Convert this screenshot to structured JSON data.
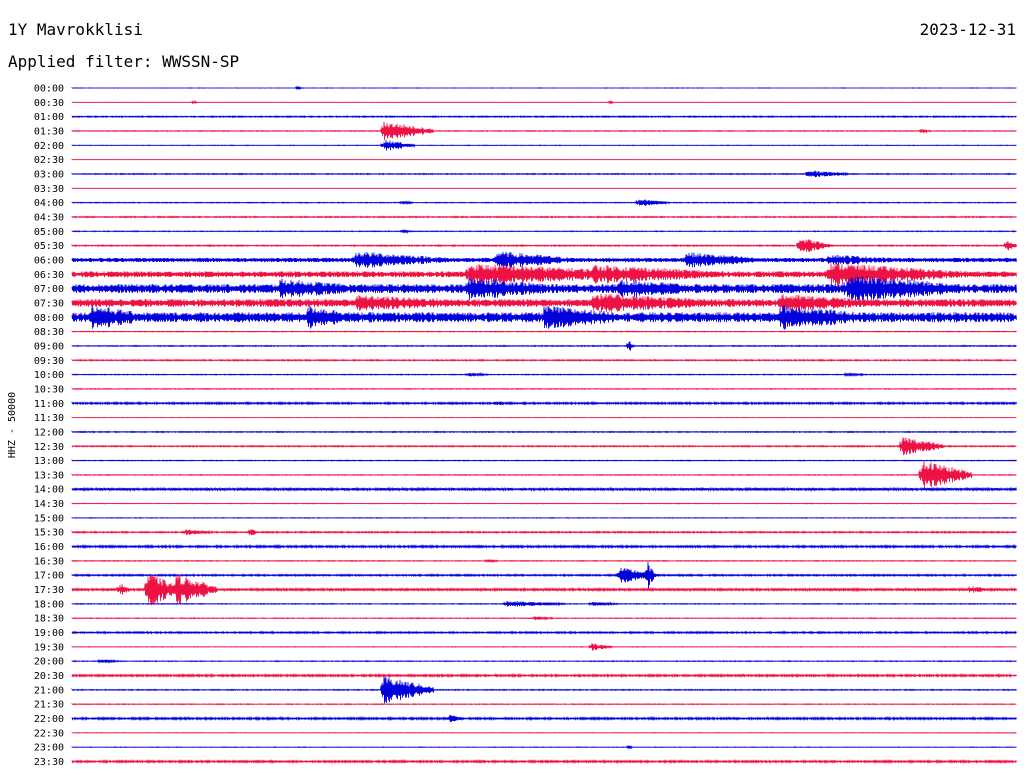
{
  "header": {
    "station": "1Y Mavrokklisi",
    "date": "2023-12-31",
    "filter": "Applied filter: WWSSN-SP"
  },
  "chart_data": {
    "type": "line",
    "title": "1Y Mavrokklisi",
    "ylabel": "HHZ - 50000",
    "colors": [
      "#0000dd",
      "#ee1144"
    ],
    "rows": [
      {
        "time": "00:00",
        "level": 0.2,
        "events": [
          {
            "x": 0.24,
            "amp": 2,
            "dur": 0.002
          }
        ]
      },
      {
        "time": "00:30",
        "level": 0.2,
        "events": [
          {
            "x": 0.13,
            "amp": 2,
            "dur": 0.002
          },
          {
            "x": 0.57,
            "amp": 2,
            "dur": 0.003
          }
        ]
      },
      {
        "time": "01:00",
        "level": 0.6,
        "events": []
      },
      {
        "time": "01:30",
        "level": 0.4,
        "events": [
          {
            "x": 0.33,
            "amp": 10,
            "dur": 0.05
          },
          {
            "x": 0.9,
            "amp": 2,
            "dur": 0.01
          }
        ]
      },
      {
        "time": "02:00",
        "level": 0.3,
        "events": [
          {
            "x": 0.33,
            "amp": 6,
            "dur": 0.03
          }
        ]
      },
      {
        "time": "02:30",
        "level": 0.2,
        "events": []
      },
      {
        "time": "03:00",
        "level": 0.5,
        "events": [
          {
            "x": 0.78,
            "amp": 4,
            "dur": 0.04
          }
        ]
      },
      {
        "time": "03:30",
        "level": 0.2,
        "events": []
      },
      {
        "time": "04:00",
        "level": 0.4,
        "events": [
          {
            "x": 0.35,
            "amp": 2,
            "dur": 0.01
          },
          {
            "x": 0.6,
            "amp": 4,
            "dur": 0.03
          }
        ]
      },
      {
        "time": "04:30",
        "level": 0.6,
        "events": []
      },
      {
        "time": "05:00",
        "level": 0.4,
        "events": [
          {
            "x": 0.35,
            "amp": 2,
            "dur": 0.01
          }
        ]
      },
      {
        "time": "05:30",
        "level": 0.6,
        "events": [
          {
            "x": 0.77,
            "amp": 9,
            "dur": 0.03
          },
          {
            "x": 0.99,
            "amp": 6,
            "dur": 0.01
          }
        ]
      },
      {
        "time": "06:00",
        "level": 2.2,
        "events": [
          {
            "x": 0.3,
            "amp": 9,
            "dur": 0.1
          },
          {
            "x": 0.45,
            "amp": 9,
            "dur": 0.08
          },
          {
            "x": 0.65,
            "amp": 8,
            "dur": 0.08
          },
          {
            "x": 0.8,
            "amp": 6,
            "dur": 0.08
          }
        ]
      },
      {
        "time": "06:30",
        "level": 3.0,
        "events": [
          {
            "x": 0.42,
            "amp": 11,
            "dur": 0.2
          },
          {
            "x": 0.55,
            "amp": 10,
            "dur": 0.15
          },
          {
            "x": 0.8,
            "amp": 12,
            "dur": 0.15
          }
        ]
      },
      {
        "time": "07:00",
        "level": 4.5,
        "events": [
          {
            "x": 0.22,
            "amp": 10,
            "dur": 0.1
          },
          {
            "x": 0.42,
            "amp": 12,
            "dur": 0.1
          },
          {
            "x": 0.58,
            "amp": 10,
            "dur": 0.1
          },
          {
            "x": 0.82,
            "amp": 14,
            "dur": 0.14
          }
        ]
      },
      {
        "time": "07:30",
        "level": 4.0,
        "events": [
          {
            "x": 0.3,
            "amp": 8,
            "dur": 0.15
          },
          {
            "x": 0.55,
            "amp": 10,
            "dur": 0.15
          },
          {
            "x": 0.75,
            "amp": 9,
            "dur": 0.12
          }
        ]
      },
      {
        "time": "08:00",
        "level": 5.0,
        "events": [
          {
            "x": 0.02,
            "amp": 13,
            "dur": 0.06
          },
          {
            "x": 0.25,
            "amp": 12,
            "dur": 0.06
          },
          {
            "x": 0.5,
            "amp": 12,
            "dur": 0.1
          },
          {
            "x": 0.75,
            "amp": 13,
            "dur": 0.1
          }
        ]
      },
      {
        "time": "08:30",
        "level": 0.4,
        "events": []
      },
      {
        "time": "09:00",
        "level": 0.5,
        "events": [
          {
            "x": 0.59,
            "amp": 6,
            "dur": 0.004
          }
        ]
      },
      {
        "time": "09:30",
        "level": 0.6,
        "events": []
      },
      {
        "time": "10:00",
        "level": 0.4,
        "events": [
          {
            "x": 0.42,
            "amp": 2,
            "dur": 0.02
          },
          {
            "x": 0.82,
            "amp": 2,
            "dur": 0.02
          }
        ]
      },
      {
        "time": "10:30",
        "level": 0.4,
        "events": []
      },
      {
        "time": "11:00",
        "level": 0.9,
        "events": [
          {
            "x": 0.45,
            "amp": 3,
            "dur": 0.01
          }
        ]
      },
      {
        "time": "11:30",
        "level": 0.2,
        "events": []
      },
      {
        "time": "12:00",
        "level": 0.5,
        "events": []
      },
      {
        "time": "12:30",
        "level": 0.6,
        "events": [
          {
            "x": 0.88,
            "amp": 10,
            "dur": 0.04
          }
        ]
      },
      {
        "time": "13:00",
        "level": 0.4,
        "events": []
      },
      {
        "time": "13:30",
        "level": 0.4,
        "events": [
          {
            "x": 0.9,
            "amp": 15,
            "dur": 0.05
          }
        ]
      },
      {
        "time": "14:00",
        "level": 1.2,
        "events": []
      },
      {
        "time": "14:30",
        "level": 0.3,
        "events": []
      },
      {
        "time": "15:00",
        "level": 0.3,
        "events": []
      },
      {
        "time": "15:30",
        "level": 0.7,
        "events": [
          {
            "x": 0.12,
            "amp": 3,
            "dur": 0.03
          },
          {
            "x": 0.19,
            "amp": 7,
            "dur": 0.004
          }
        ]
      },
      {
        "time": "16:00",
        "level": 1.0,
        "events": []
      },
      {
        "time": "16:30",
        "level": 0.4,
        "events": [
          {
            "x": 0.44,
            "amp": 2,
            "dur": 0.01
          }
        ]
      },
      {
        "time": "17:00",
        "level": 0.8,
        "events": [
          {
            "x": 0.58,
            "amp": 8,
            "dur": 0.04
          },
          {
            "x": 0.61,
            "amp": 14,
            "dur": 0.006
          }
        ]
      },
      {
        "time": "17:30",
        "level": 1.2,
        "events": [
          {
            "x": 0.05,
            "amp": 7,
            "dur": 0.01
          },
          {
            "x": 0.08,
            "amp": 18,
            "dur": 0.03
          },
          {
            "x": 0.11,
            "amp": 16,
            "dur": 0.04
          },
          {
            "x": 0.95,
            "amp": 4,
            "dur": 0.02
          }
        ]
      },
      {
        "time": "18:00",
        "level": 0.4,
        "events": [
          {
            "x": 0.46,
            "amp": 3,
            "dur": 0.06
          },
          {
            "x": 0.55,
            "amp": 2,
            "dur": 0.03
          }
        ]
      },
      {
        "time": "18:30",
        "level": 0.4,
        "events": [
          {
            "x": 0.49,
            "amp": 2,
            "dur": 0.02
          }
        ]
      },
      {
        "time": "19:00",
        "level": 0.8,
        "events": []
      },
      {
        "time": "19:30",
        "level": 0.3,
        "events": [
          {
            "x": 0.55,
            "amp": 4,
            "dur": 0.02
          }
        ]
      },
      {
        "time": "20:00",
        "level": 0.4,
        "events": [
          {
            "x": 0.03,
            "amp": 2,
            "dur": 0.02
          }
        ]
      },
      {
        "time": "20:30",
        "level": 1.0,
        "events": []
      },
      {
        "time": "21:00",
        "level": 0.5,
        "events": [
          {
            "x": 0.33,
            "amp": 14,
            "dur": 0.05
          }
        ]
      },
      {
        "time": "21:30",
        "level": 0.4,
        "events": []
      },
      {
        "time": "22:00",
        "level": 1.0,
        "events": [
          {
            "x": 0.4,
            "amp": 4,
            "dur": 0.015
          }
        ]
      },
      {
        "time": "22:30",
        "level": 0.3,
        "events": []
      },
      {
        "time": "23:00",
        "level": 0.3,
        "events": [
          {
            "x": 0.59,
            "amp": 2,
            "dur": 0.003
          }
        ]
      },
      {
        "time": "23:30",
        "level": 1.0,
        "events": []
      }
    ]
  }
}
